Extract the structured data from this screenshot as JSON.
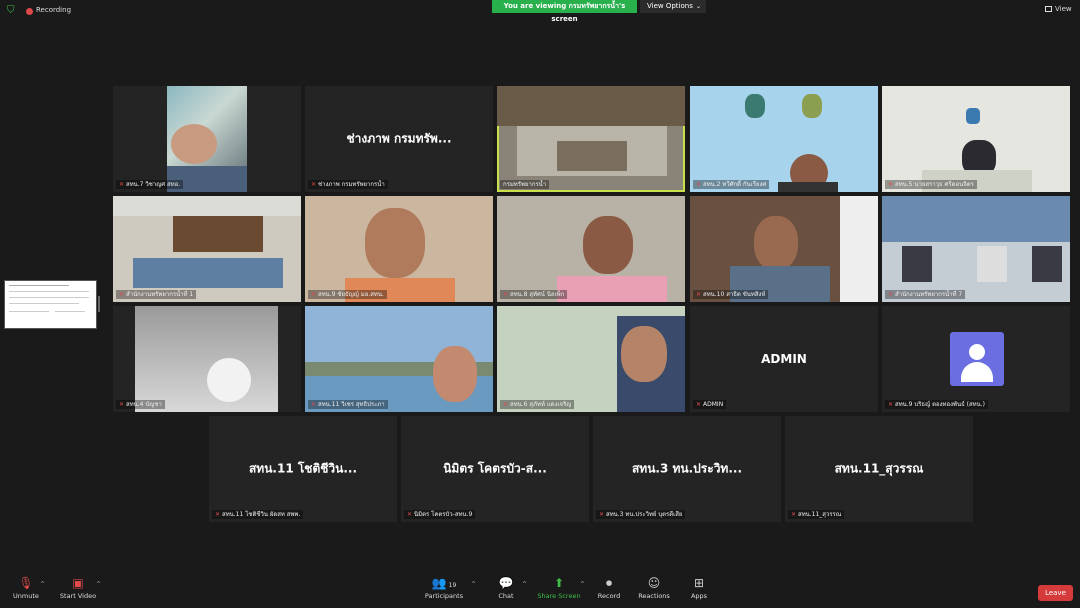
{
  "top": {
    "recording_label": "Recording",
    "viewing_banner": "You are viewing กรมทรัพยากรน้ำ's screen",
    "view_options_label": "View Options",
    "view_label": "View"
  },
  "tiles": [
    {
      "name": "สทน.7 วิชาญศ สทอ.",
      "muted": true
    },
    {
      "name": "ช่างภาพ กรมทรัพยากรน้ำ",
      "big": "ช่างภาพ กรมทรัพ...",
      "muted": true
    },
    {
      "name": "กรมทรัพยากรน้ำ",
      "muted": false
    },
    {
      "name": "สทน.2 ทวีศักดิ์ กันเรียงศ",
      "muted": true
    },
    {
      "name": "สทน.5 นายสราวุธ ศรีดอนจิตร",
      "muted": true
    },
    {
      "name": "สำนักงานทรัพยากรน้ำที่ 1",
      "muted": true
    },
    {
      "name": "สทน.9 ชัยธัญญ์ มอ.สทน.",
      "muted": true
    },
    {
      "name": "สทน.8 สุทัศน์ นิลเพ็ก",
      "muted": true
    },
    {
      "name": "สทน.10 สาธิต ขันทสิงห์",
      "muted": true
    },
    {
      "name": "สำนักงานทรัพยากรน้ำที่ 7",
      "muted": true
    },
    {
      "name": "สทน.4 บัญชา",
      "muted": true
    },
    {
      "name": "สทน.11 วิเชร สุทธิประภา",
      "muted": true
    },
    {
      "name": "สทน.6 สุภัทท์ แดงเจริญ",
      "muted": true
    },
    {
      "name": "ADMIN",
      "big": "ADMIN",
      "muted": true
    },
    {
      "name": "สทน.9 บริธญ์ ตองทองพันธ์ (สทน.)",
      "muted": true
    },
    {
      "name": "สทน.11 โชติชีวิน ผัดสท สพพ.",
      "big": "สทน.11 โชติชีวิน...",
      "muted": true
    },
    {
      "name": "นิมิตร โคตรบัว-สทน.9",
      "big": "นิมิตร โคตรบัว-ส...",
      "muted": true
    },
    {
      "name": "สทน.3 ทน.ประวิทย์ บุตรดีเสีย",
      "big": "สทน.3 ทน.ประวิท...",
      "muted": true
    },
    {
      "name": "สทน.11_สุวรรณ",
      "big": "สทน.11_สุวรรณ",
      "muted": true
    }
  ],
  "toolbar": {
    "unmute": "Unmute",
    "start_video": "Start Video",
    "participants": "Participants",
    "participants_count": "19",
    "chat": "Chat",
    "share_screen": "Share Screen",
    "record": "Record",
    "reactions": "Reactions",
    "apps": "Apps",
    "leave": "Leave"
  },
  "colors": {
    "active_speaker": "#c8e04a",
    "share_green": "#27b04b",
    "leave_red": "#d63b3b",
    "muted_red": "#e04a4a"
  }
}
